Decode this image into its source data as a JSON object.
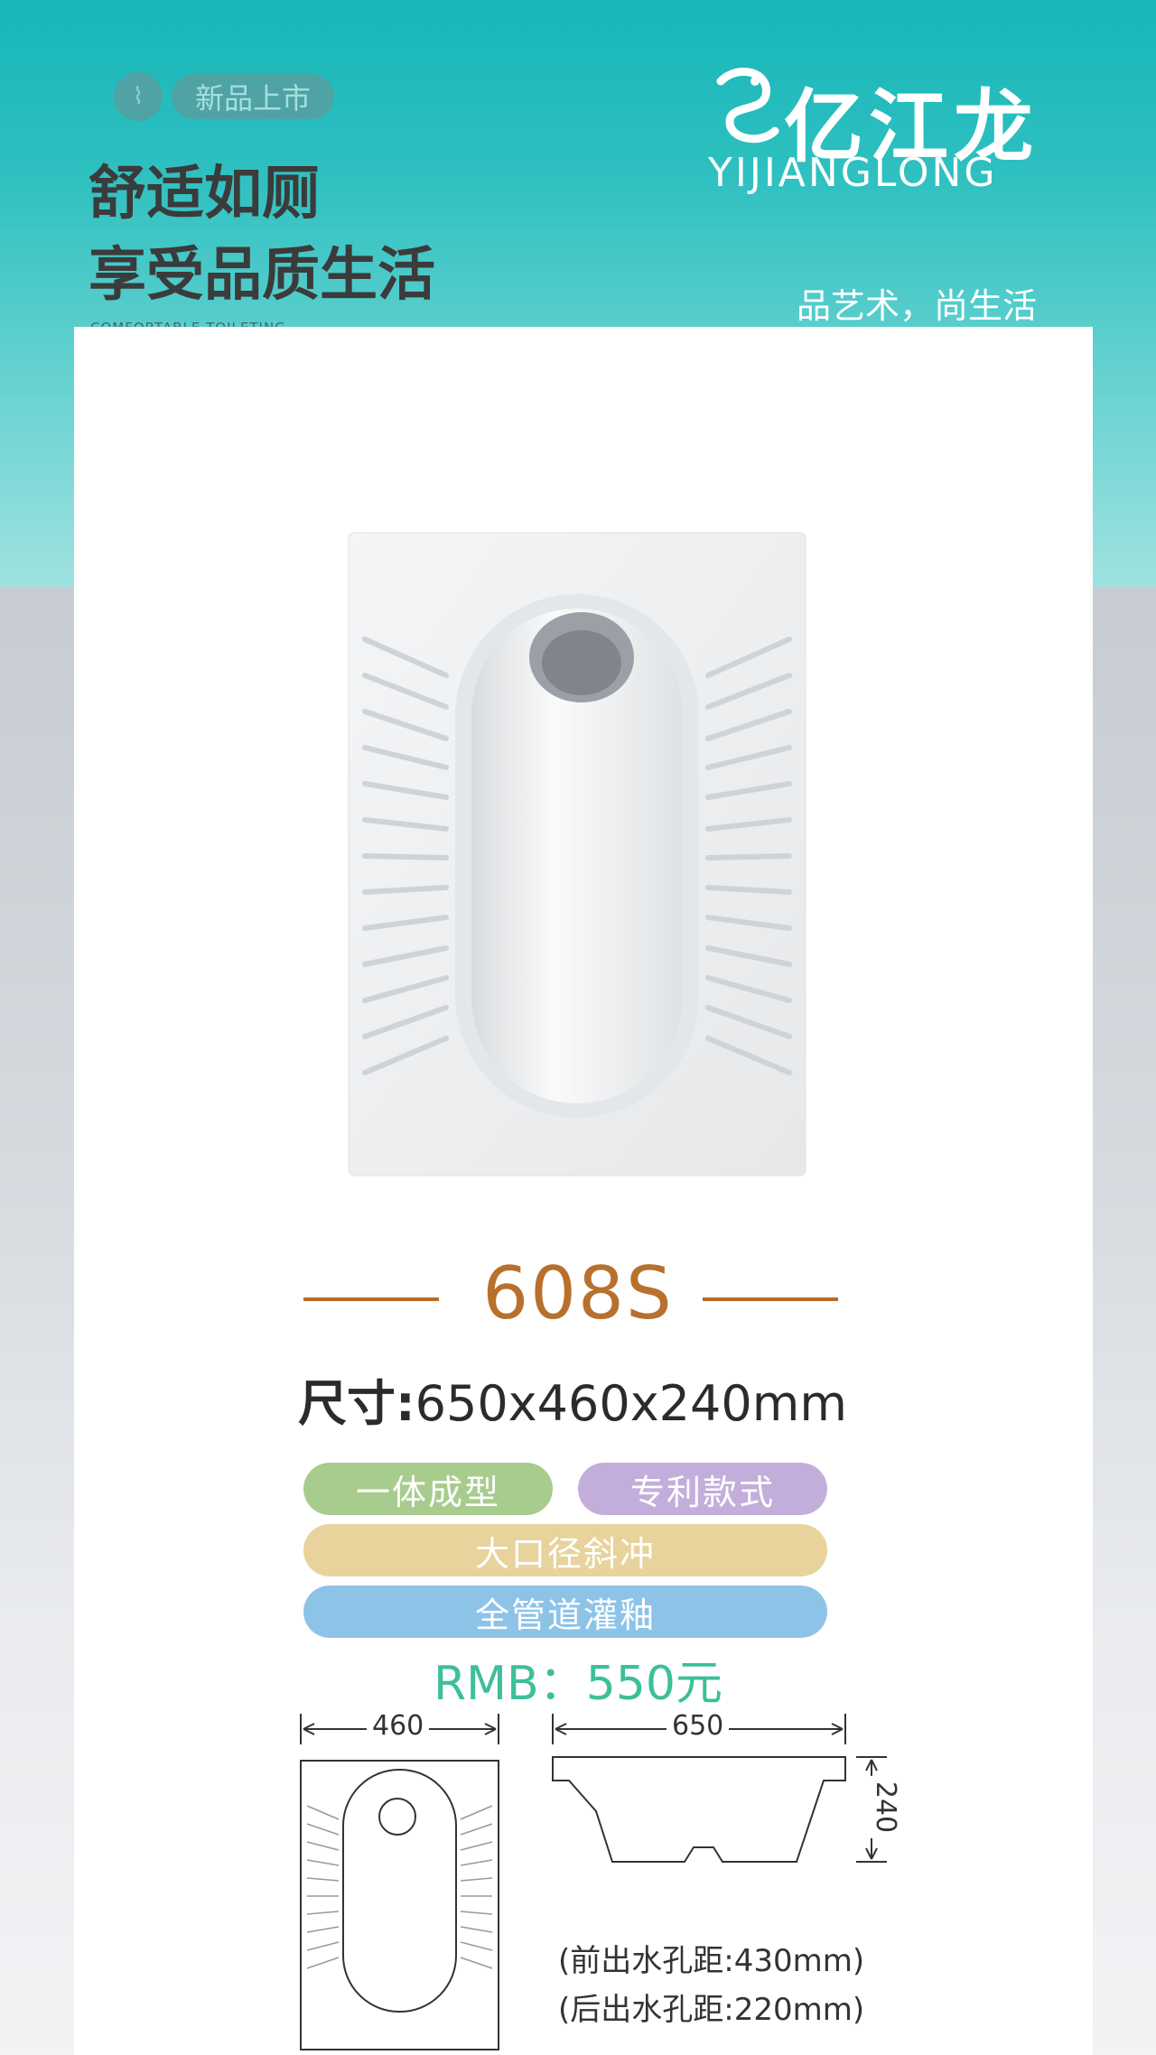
{
  "header": {
    "badge_label": "新品上市",
    "slogan_line1": "舒适如厕",
    "slogan_line2": "享受品质生活",
    "slogan_en": "COMFORTABLE TOILETING",
    "brand_cn": "亿江龙",
    "brand_en": "YIJIANGLONG",
    "tagline": "品艺术，尚生活",
    "colors": {
      "teal": "#17b6b8",
      "card": "#ffffff"
    }
  },
  "product": {
    "model": "608S",
    "size_label": "尺寸:",
    "size_value": "650x460x240mm",
    "features": [
      {
        "label": "一体成型",
        "color": "#a8cc8e"
      },
      {
        "label": "专利款式",
        "color": "#c3aedb"
      },
      {
        "label": "大口径斜冲",
        "color": "#e8d39c"
      },
      {
        "label": "全管道灌釉",
        "color": "#8ec3e8"
      }
    ],
    "price": "RMB：550元",
    "price_color": "#3dbf9a",
    "accent_color": "#b8702d"
  },
  "diagram": {
    "width_label": "460",
    "length_label": "650",
    "height_label": "240",
    "note_front": "(前出水孔距:430mm)",
    "note_back": "(后出水孔距:220mm)"
  }
}
